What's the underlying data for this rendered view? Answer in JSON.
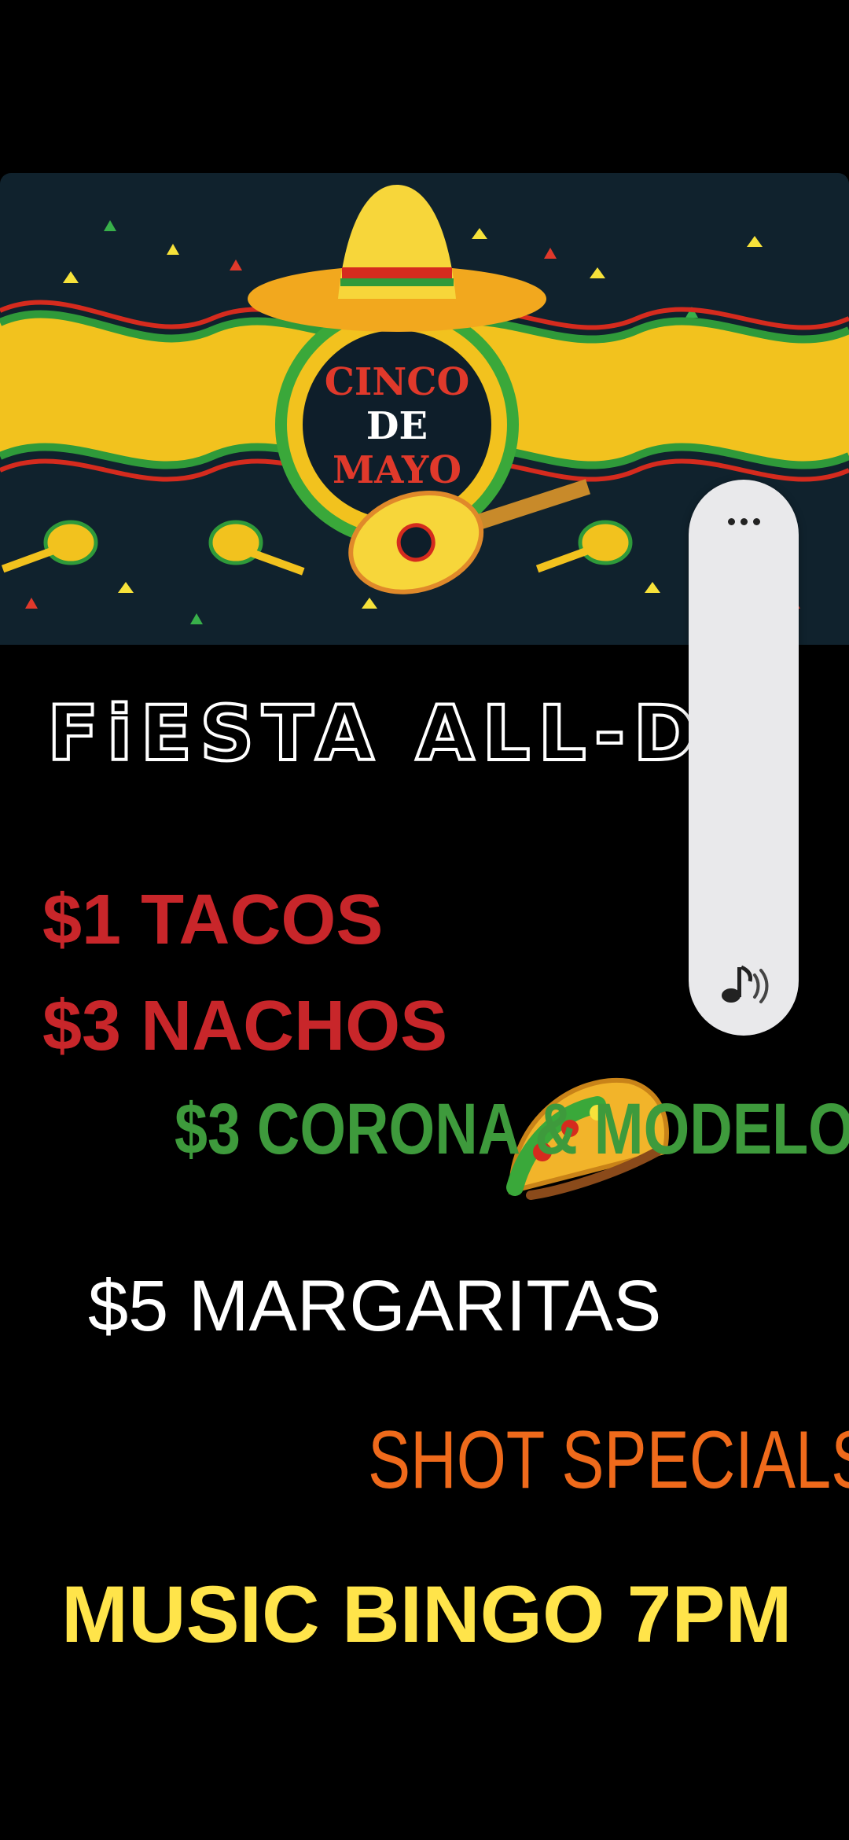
{
  "flyer": {
    "banner_title": [
      "CINCO",
      "DE",
      "MAYO"
    ],
    "headline": "FiESTA  ALL-DA",
    "specials": [
      "$1 TACOS",
      "$3 NACHOS",
      "$3 CORONA & MODELO",
      "$5 MARGARITAS",
      "SHOT SPECIALS",
      "MUSIC BINGO 7PM"
    ]
  },
  "side_panel": {
    "more_icon": "more-horizontal-icon",
    "sound_icon": "music-note-sound-icon"
  },
  "colors": {
    "red": "#c8262a",
    "green": "#3e9a3c",
    "orange": "#ef6a1b",
    "yellow": "#ffe44a",
    "banner_bg": "#10222d"
  }
}
